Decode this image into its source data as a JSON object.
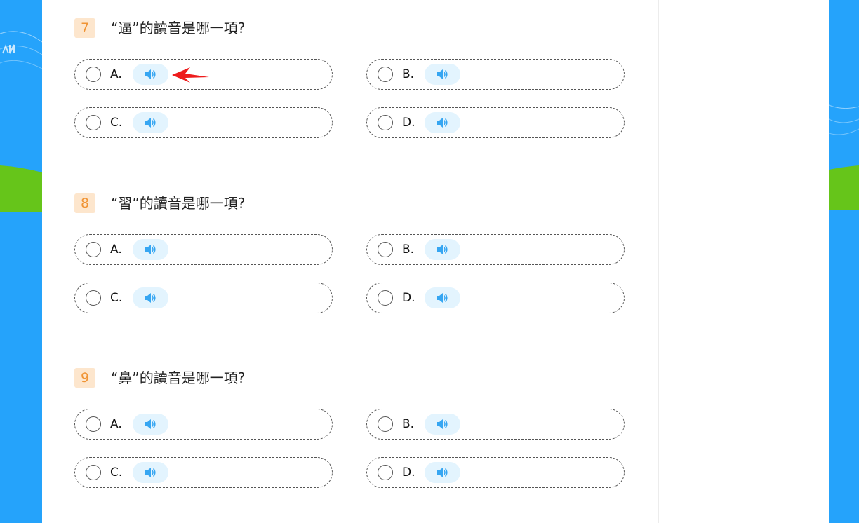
{
  "questions": [
    {
      "number": "7",
      "title": "“逼”的讀音是哪一項?",
      "options": [
        {
          "letter": "A."
        },
        {
          "letter": "B."
        },
        {
          "letter": "C."
        },
        {
          "letter": "D."
        }
      ]
    },
    {
      "number": "8",
      "title": "“習”的讀音是哪一項?",
      "options": [
        {
          "letter": "A."
        },
        {
          "letter": "B."
        },
        {
          "letter": "C."
        },
        {
          "letter": "D."
        }
      ]
    },
    {
      "number": "9",
      "title": "“鼻”的讀音是哪一項?",
      "options": [
        {
          "letter": "A."
        },
        {
          "letter": "B."
        },
        {
          "letter": "C."
        },
        {
          "letter": "D."
        }
      ]
    }
  ],
  "icons": {
    "audio": "speaker-icon",
    "radio": "radio-circle-icon",
    "pointer": "red-arrow-annotation"
  },
  "colors": {
    "background_blue": "#25a3fb",
    "number_badge_bg": "#fde6cd",
    "number_badge_text": "#f09435",
    "audio_button_bg": "#e3f4fe",
    "audio_icon": "#36a6f2",
    "hill_green": "#66c51a",
    "annotation_red": "#ee1c1c"
  }
}
